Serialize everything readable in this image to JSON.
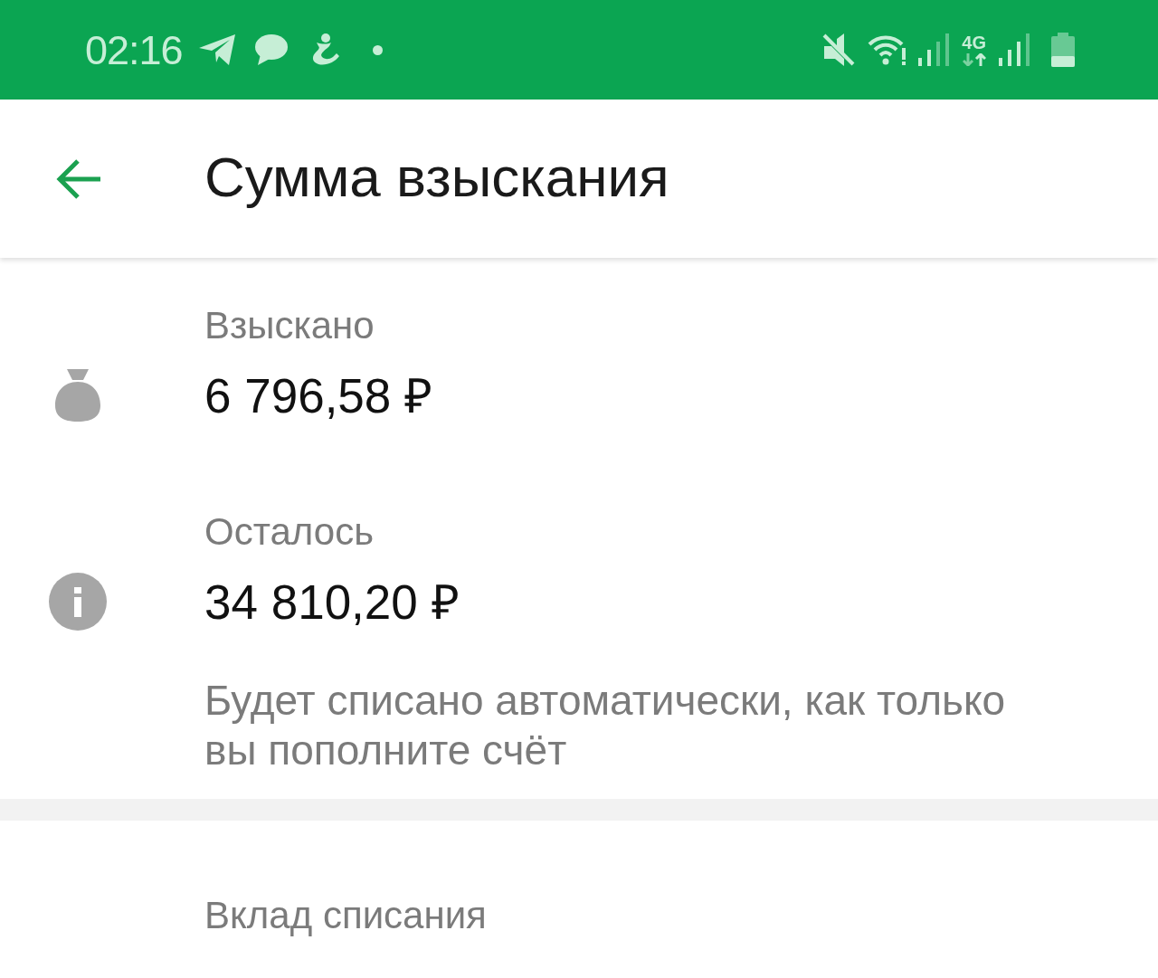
{
  "status_bar": {
    "time": "02:16",
    "network": "4G"
  },
  "app_bar": {
    "title": "Сумма взыскания"
  },
  "details": [
    {
      "kind": "collected",
      "label": "Взыскано",
      "value": "6 796,58 ₽"
    },
    {
      "kind": "remaining",
      "label": "Осталось",
      "value": "34 810,20 ₽",
      "note": "Будет списано автоматически, как только вы пополните счёт"
    }
  ],
  "debit_account": {
    "label": "Вклад списания"
  }
}
